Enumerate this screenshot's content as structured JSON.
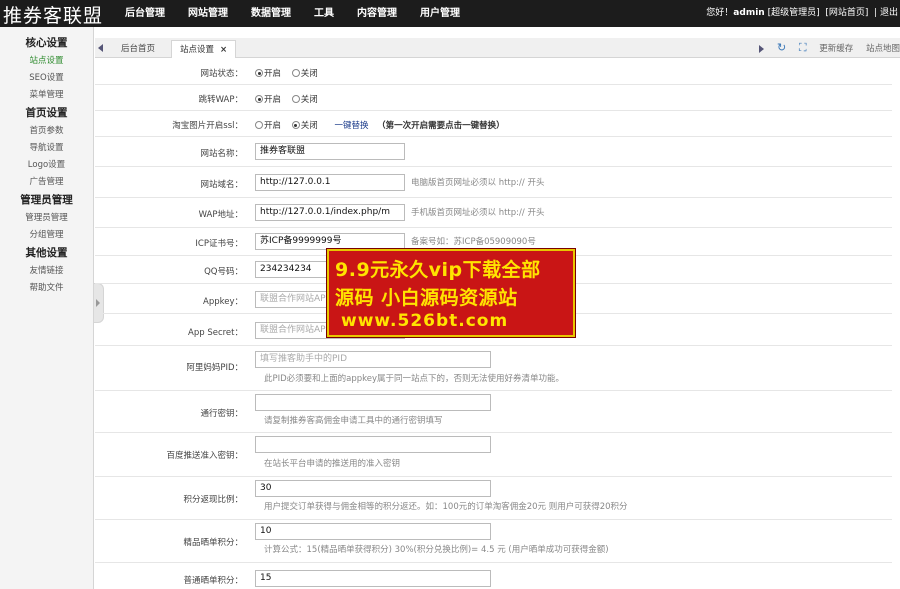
{
  "app": {
    "logo_text": "推券客联盟",
    "nav": [
      "后台管理",
      "网站管理",
      "数据管理",
      "工具",
      "内容管理",
      "用户管理"
    ],
    "greeting": "您好！",
    "username": "admin",
    "role": "[超级管理员]",
    "site_home": "[网站首页]",
    "logout": "| 退出"
  },
  "sidebar": {
    "groups": [
      {
        "title": "核心设置",
        "items": [
          "站点设置",
          "SEO设置",
          "菜单管理"
        ]
      },
      {
        "title": "首页设置",
        "items": [
          "首页参数",
          "导航设置",
          "Logo设置",
          "广告管理"
        ]
      },
      {
        "title": "管理员管理",
        "items": [
          "管理员管理",
          "分组管理"
        ]
      },
      {
        "title": "其他设置",
        "items": [
          "友情链接",
          "帮助文件"
        ]
      }
    ],
    "active_item": "站点设置"
  },
  "tabs": {
    "home": "后台首页",
    "current": "站点设置",
    "close": "×",
    "refresh_icon": "↻",
    "fullscreen_icon": "⛶",
    "update_cache": "更新缓存",
    "site_map": "站点地图"
  },
  "form": {
    "site_status": {
      "label": "网站状态：",
      "options": [
        "开启",
        "关闭"
      ],
      "selected": "开启"
    },
    "wap_redirect": {
      "label": "跳转WAP：",
      "options": [
        "开启",
        "关闭"
      ],
      "selected": "开启"
    },
    "taobao_ssl": {
      "label": "淘宝图片开启ssl：",
      "options": [
        "开启",
        "关闭"
      ],
      "selected": "关闭",
      "link": "一键替换",
      "note": "（第一次开启需要点击一键替换）"
    },
    "site_name": {
      "label": "网站名称：",
      "value": "推券客联盟"
    },
    "domain": {
      "label": "网站域名：",
      "value": "http://127.0.0.1",
      "hint": "电脑版首页网址必须以 http:// 开头"
    },
    "wap_url": {
      "label": "WAP地址：",
      "value": "http://127.0.0.1/index.php/m",
      "hint": "手机版首页网址必须以 http:// 开头"
    },
    "icp": {
      "label": "ICP证书号：",
      "value": "苏ICP备9999999号",
      "hint": "备案号如：苏ICP备05909090号"
    },
    "qq": {
      "label": "QQ号码：",
      "value": "234234234"
    },
    "appkey": {
      "label": "Appkey：",
      "placeholder": "联盟合作网站API"
    },
    "app_secret": {
      "label": "App Secret：",
      "placeholder": "联盟合作网站API"
    },
    "pid": {
      "label": "阿里妈妈PID：",
      "placeholder": "填写推客助手中的PID",
      "sub": "此PID必须要和上面的appkey属于同一站点下的，否则无法使用好券清单功能。"
    },
    "general_key": {
      "label": "通行密钥：",
      "value": "",
      "sub": "请复制推券客高佣金申请工具中的通行密钥填写"
    },
    "baidu_key": {
      "label": "百度推送准入密钥：",
      "value": "",
      "sub": "在站长平台申请的推送用的准入密钥"
    },
    "points_ratio": {
      "label": "积分返现比例：",
      "value": "30",
      "sub": "用户提交订单获得与佣金相等的积分返还。如：100元的订单淘客佣金20元 则用户可获得20积分"
    },
    "premium_points": {
      "label": "精品晒单积分：",
      "value": "10",
      "sub": "计算公式：15(精品晒单获得积分) 30%(积分兑换比例)= 4.5 元 (用户晒单成功可获得金额)"
    },
    "normal_points": {
      "label": "普通晒单积分：",
      "value": "15"
    }
  },
  "watermark": {
    "line1": "9.9元永久vip下载全部",
    "line2": "源码  小白源码资源站",
    "line3": "www.526bt.com"
  }
}
